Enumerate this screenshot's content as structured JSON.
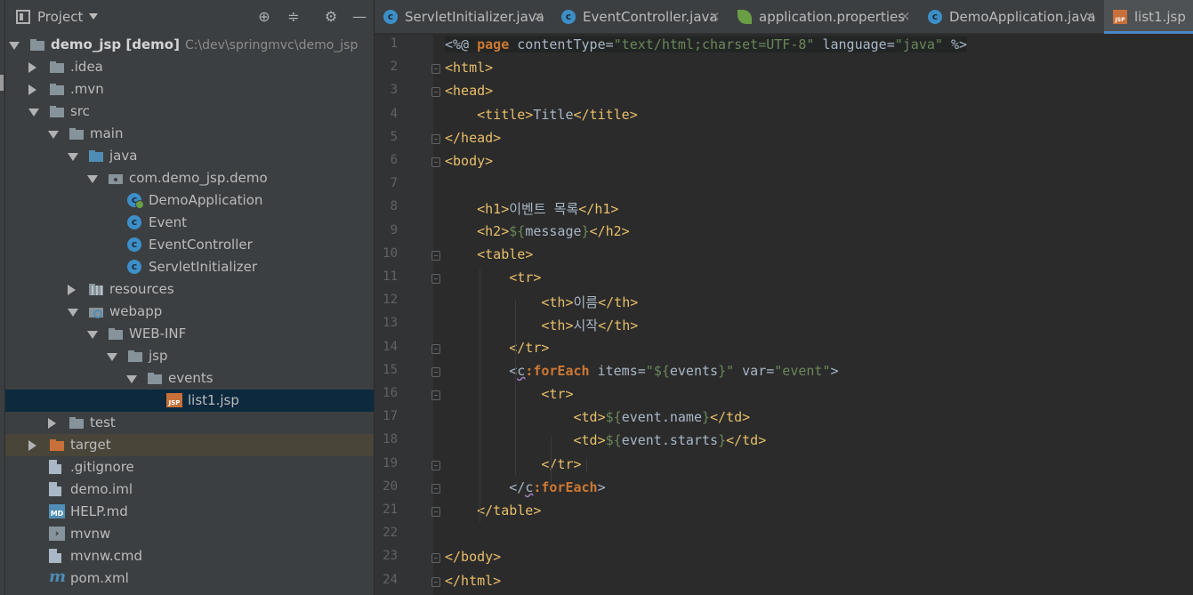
{
  "project_panel": {
    "title": "Project",
    "tree": [
      {
        "label": "demo_jsp [demo]",
        "bold_part": "demo_jsp [demo]",
        "path": "C:\\dev\\springmvc\\demo_jsp",
        "icon": "module-icon",
        "depth": 0,
        "state": "open"
      },
      {
        "label": ".idea",
        "icon": "folder-icon",
        "depth": 1,
        "state": "closed"
      },
      {
        "label": ".mvn",
        "icon": "folder-icon",
        "depth": 1,
        "state": "closed"
      },
      {
        "label": "src",
        "icon": "folder-icon",
        "depth": 1,
        "state": "open"
      },
      {
        "label": "main",
        "icon": "folder-icon",
        "depth": 2,
        "state": "open"
      },
      {
        "label": "java",
        "icon": "source-folder-icon",
        "depth": 3,
        "state": "open"
      },
      {
        "label": "com.demo_jsp.demo",
        "icon": "package-icon",
        "depth": 4,
        "state": "open"
      },
      {
        "label": "DemoApplication",
        "icon": "spring-boot-class-icon",
        "depth": 5,
        "state": "none"
      },
      {
        "label": "Event",
        "icon": "class-icon",
        "depth": 5,
        "state": "none"
      },
      {
        "label": "EventController",
        "icon": "class-icon",
        "depth": 5,
        "state": "none"
      },
      {
        "label": "ServletInitializer",
        "icon": "class-icon",
        "depth": 5,
        "state": "none"
      },
      {
        "label": "resources",
        "icon": "resources-folder-icon",
        "depth": 3,
        "state": "closed"
      },
      {
        "label": "webapp",
        "icon": "web-folder-icon",
        "depth": 3,
        "state": "open"
      },
      {
        "label": "WEB-INF",
        "icon": "folder-icon",
        "depth": 4,
        "state": "open"
      },
      {
        "label": "jsp",
        "icon": "folder-icon",
        "depth": 5,
        "state": "open"
      },
      {
        "label": "events",
        "icon": "folder-icon",
        "depth": 6,
        "state": "open"
      },
      {
        "label": "list1.jsp",
        "icon": "jsp-file-icon",
        "depth": 7,
        "state": "none",
        "selected": true
      },
      {
        "label": "test",
        "icon": "folder-icon",
        "depth": 2,
        "state": "closed"
      },
      {
        "label": "target",
        "icon": "excluded-folder-icon",
        "depth": 1,
        "state": "closed",
        "excluded": true
      },
      {
        "label": ".gitignore",
        "icon": "ignore-file-icon",
        "depth": 1,
        "state": "none"
      },
      {
        "label": "demo.iml",
        "icon": "iml-file-icon",
        "depth": 1,
        "state": "none"
      },
      {
        "label": "HELP.md",
        "icon": "markdown-file-icon",
        "depth": 1,
        "state": "none"
      },
      {
        "label": "mvnw",
        "icon": "terminal-file-icon",
        "depth": 1,
        "state": "none"
      },
      {
        "label": "mvnw.cmd",
        "icon": "file-icon",
        "depth": 1,
        "state": "none"
      },
      {
        "label": "pom.xml",
        "icon": "maven-icon",
        "depth": 1,
        "state": "none"
      }
    ]
  },
  "tabs": [
    {
      "label": "ServletInitializer.java",
      "icon": "class-icon",
      "active": false
    },
    {
      "label": "EventController.java",
      "icon": "class-icon",
      "active": false
    },
    {
      "label": "application.properties",
      "icon": "spring-properties-icon",
      "active": false
    },
    {
      "label": "DemoApplication.java",
      "icon": "spring-boot-class-icon",
      "active": false
    },
    {
      "label": "list1.jsp",
      "icon": "jsp-file-icon",
      "active": true
    }
  ],
  "editor": {
    "line_numbers": [
      "1",
      "2",
      "3",
      "4",
      "5",
      "6",
      "7",
      "8",
      "9",
      "10",
      "11",
      "12",
      "13",
      "14",
      "15",
      "16",
      "17",
      "18",
      "19",
      "20",
      "21",
      "22",
      "23",
      "24"
    ],
    "lines": [
      "<%@ page contentType=\"text/html;charset=UTF-8\" language=\"java\" %>",
      "<html>",
      "<head>",
      "    <title>Title</title>",
      "</head>",
      "<body>",
      "",
      "    <h1>이벤트 목록</h1>",
      "    <h2>${message}</h2>",
      "    <table>",
      "        <tr>",
      "            <th>이름</th>",
      "            <th>시작</th>",
      "        </tr>",
      "        <c:forEach items=\"${events}\" var=\"event\">",
      "            <tr>",
      "                <td>${event.name}</td>",
      "                <td>${event.starts}</td>",
      "            </tr>",
      "        </c:forEach>",
      "    </table>",
      "",
      "</body>",
      "</html>"
    ]
  },
  "colors": {
    "editor_bg": "#2b2b2b",
    "panel_bg": "#3c3f41",
    "tag": "#e8bf6a",
    "keyword": "#cc7832",
    "string": "#6a8759",
    "text": "#a9b7c6",
    "selection": "#0d293e",
    "active_tab_underline": "#4a88c7"
  }
}
